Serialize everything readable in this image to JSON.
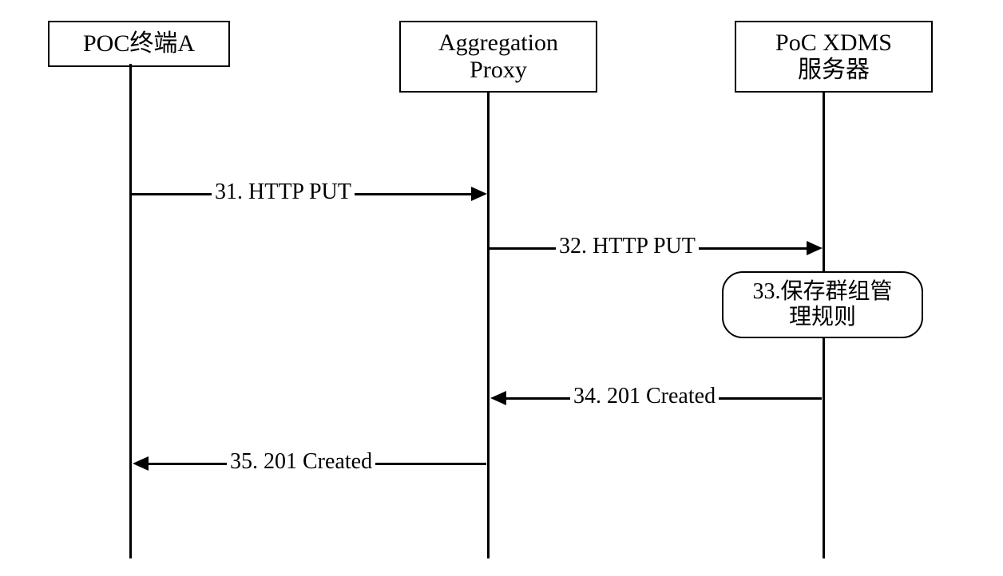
{
  "participants": {
    "a": [
      "POC终端A"
    ],
    "proxy": [
      "Aggregation",
      "Proxy"
    ],
    "xdms": [
      "PoC XDMS",
      "服务器"
    ]
  },
  "messages": {
    "m31": "31. HTTP PUT",
    "m32": "32. HTTP PUT",
    "m33a": "33.保存群组管",
    "m33b": "理规则",
    "m34": "34. 201 Created",
    "m35": "35. 201 Created"
  }
}
